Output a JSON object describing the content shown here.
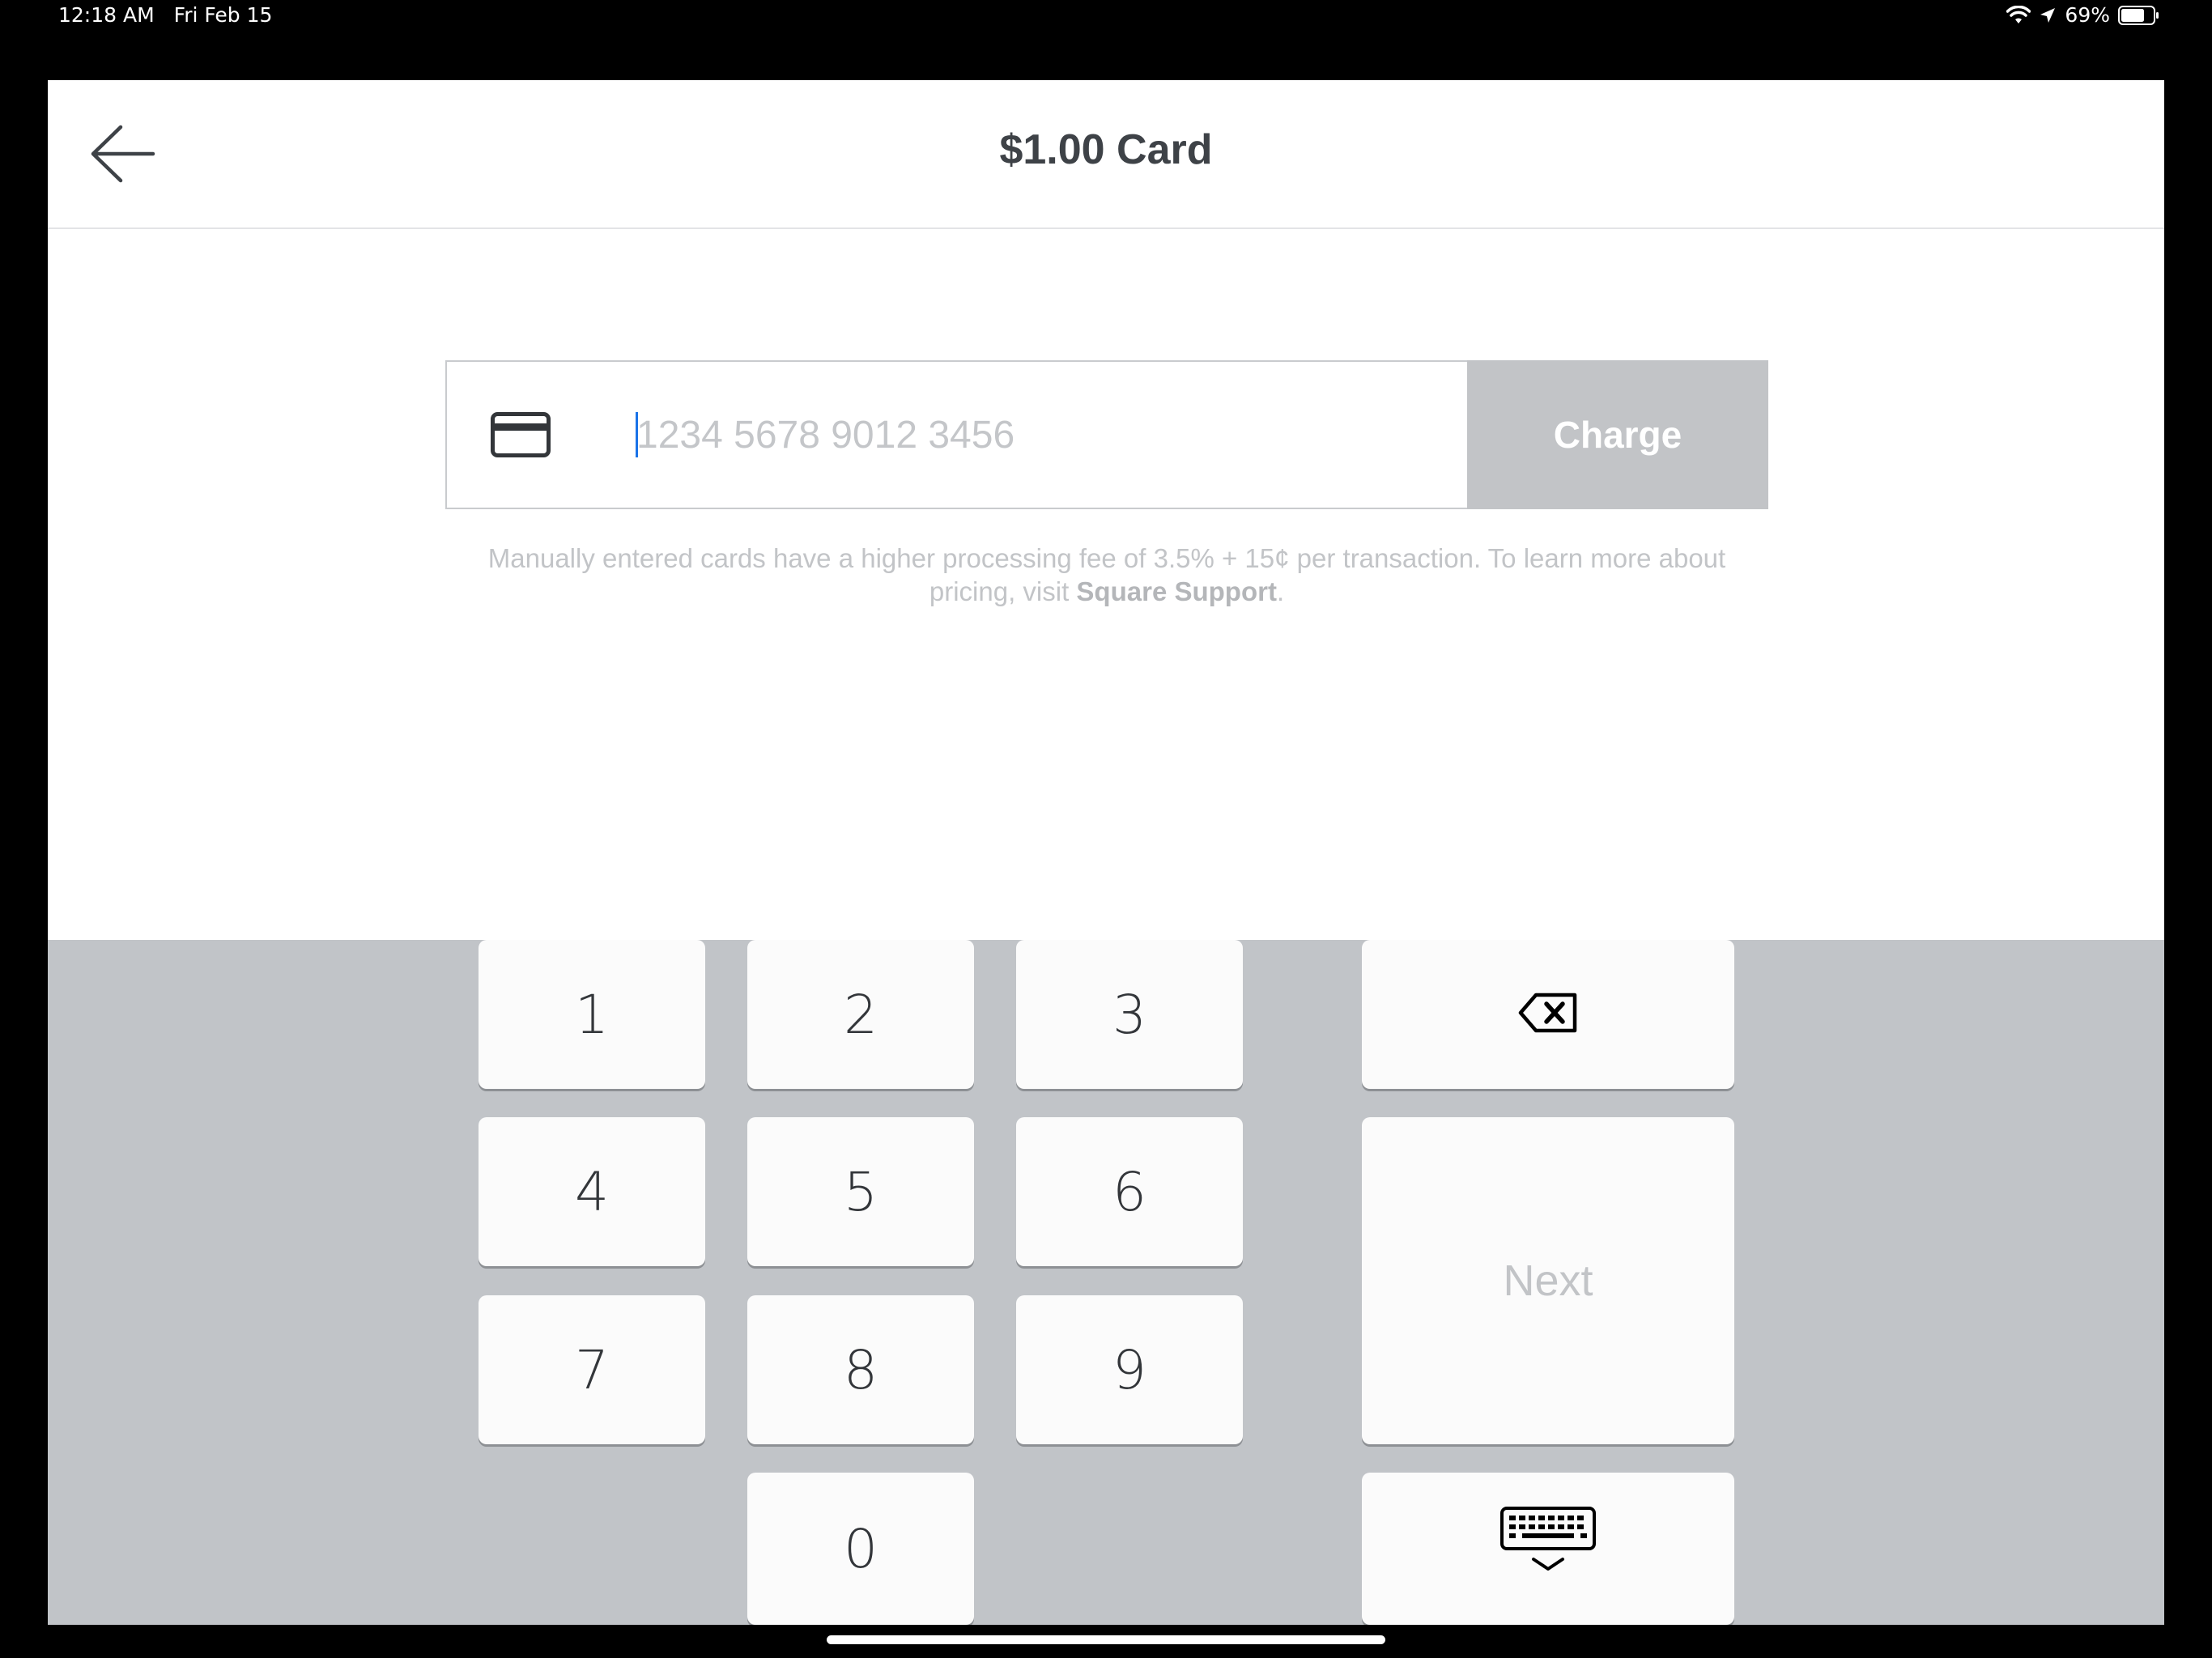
{
  "status_bar": {
    "time": "12:18 AM",
    "date": "Fri Feb 15",
    "battery": "69%",
    "icons": [
      "wifi-icon",
      "location-arrow-icon",
      "battery-icon"
    ]
  },
  "header": {
    "title": "$1.00 Card",
    "back_icon": "back-arrow-icon"
  },
  "card_entry": {
    "card_icon": "credit-card-icon",
    "input_value": "",
    "placeholder": "1234 5678 9012 3456",
    "charge_label": "Charge"
  },
  "fee_notice": {
    "text_before": "Manually entered cards have a higher processing fee of 3.5% + 15¢ per transaction. To learn more about pricing, visit ",
    "link_text": "Square Support",
    "text_after": "."
  },
  "keypad": {
    "keys": [
      "1",
      "2",
      "3",
      "4",
      "5",
      "6",
      "7",
      "8",
      "9",
      "0"
    ],
    "backspace_icon": "backspace-icon",
    "next_label": "Next",
    "hide_keyboard_icon": "hide-keyboard-icon"
  },
  "colors": {
    "keypad_background": "#c1c4c8",
    "charge_disabled": "#c2c4c7",
    "title_text": "#3e4247",
    "caret": "#1a73e8"
  }
}
